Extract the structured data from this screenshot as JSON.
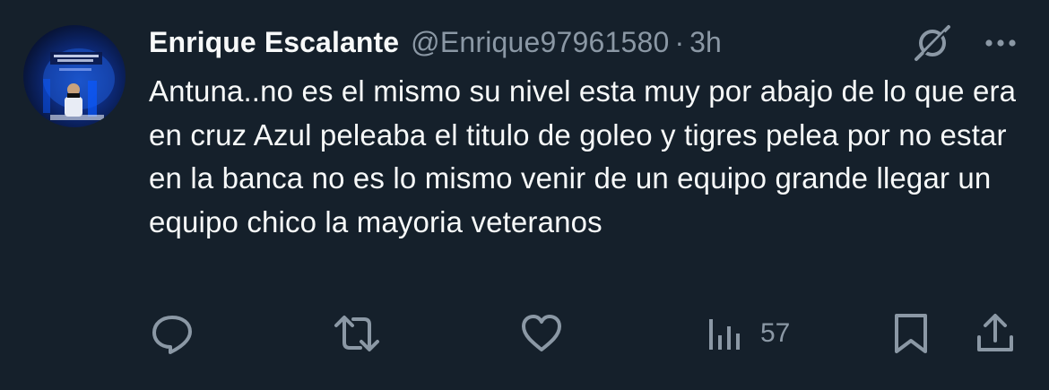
{
  "author": {
    "display_name": "Enrique Escalante",
    "handle": "@Enrique97961580",
    "separator": "·",
    "time": "3h",
    "avatar_icon": "avatar-image",
    "avatar_text": "JUNTOS HASTA EL FINAL"
  },
  "header_icons": {
    "grok": "grok-icon",
    "more": "more-icon"
  },
  "tweet": {
    "text": "Antuna..no es el mismo su nivel esta muy por abajo de lo que era en cruz Azul peleaba el titulo de goleo y tigres pelea por no estar en la banca no es lo mismo venir de un equipo grande llegar un equipo chico la mayoria veteranos"
  },
  "actions": {
    "reply_icon": "reply-icon",
    "retweet_icon": "retweet-icon",
    "like_icon": "like-icon",
    "views_icon": "views-icon",
    "views_count": "57",
    "bookmark_icon": "bookmark-icon",
    "share_icon": "share-icon"
  },
  "colors": {
    "background": "#15202b",
    "primary_text": "#f7f9f9",
    "secondary_text": "#8b98a5"
  }
}
